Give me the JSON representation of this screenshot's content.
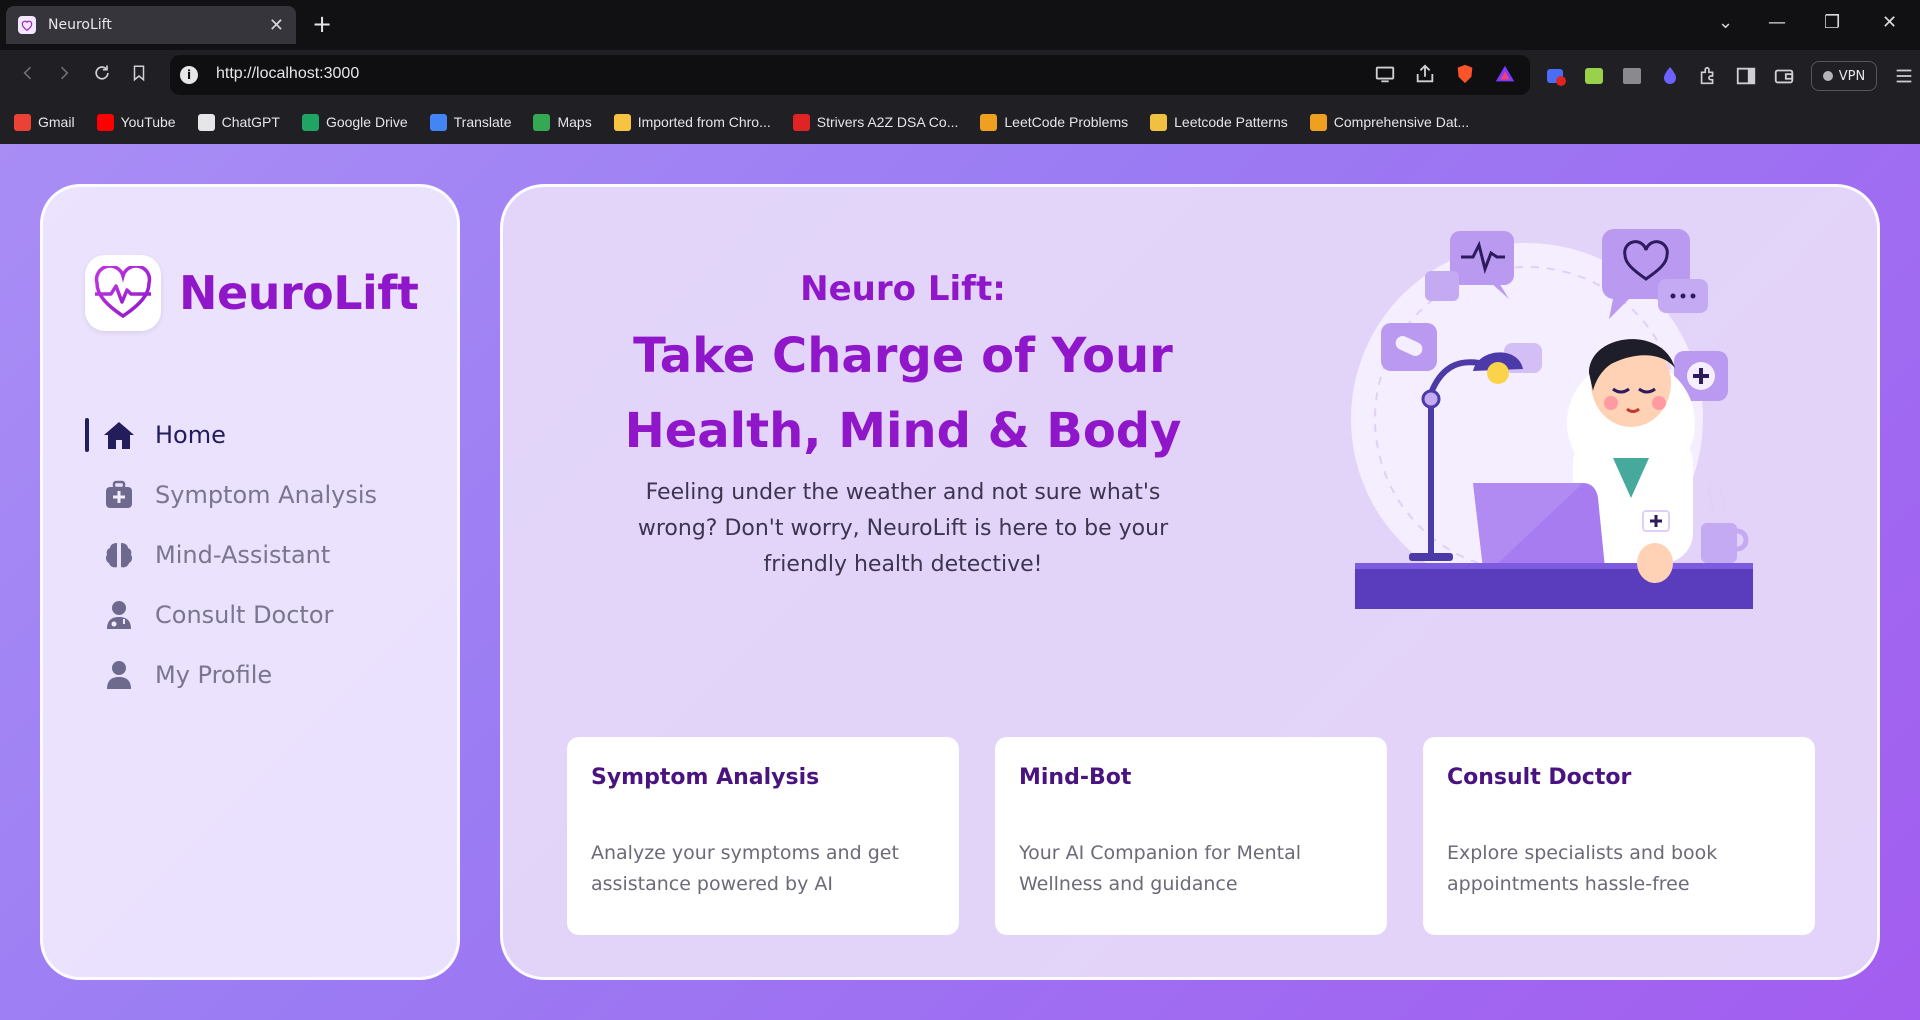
{
  "browser": {
    "tab_title": "NeuroLift",
    "new_tab": "+",
    "tab_close": "✕",
    "url": "http://localhost:3000",
    "vpn_label": "VPN",
    "window_controls": [
      "⌄",
      "—",
      "❐",
      "✕"
    ],
    "bookmarks": [
      {
        "label": "Gmail",
        "color": "#ea4335"
      },
      {
        "label": "YouTube",
        "color": "#ff0000"
      },
      {
        "label": "ChatGPT",
        "color": "#e6e6e8"
      },
      {
        "label": "Google Drive",
        "color": "#1fa463"
      },
      {
        "label": "Translate",
        "color": "#4285f4"
      },
      {
        "label": "Maps",
        "color": "#34a853"
      },
      {
        "label": "Imported from Chro...",
        "color": "#f6c343"
      },
      {
        "label": "Strivers A2Z DSA Co...",
        "color": "#e02424"
      },
      {
        "label": "LeetCode Problems",
        "color": "#f0a020"
      },
      {
        "label": "Leetcode Patterns",
        "color": "#f0c040"
      },
      {
        "label": "Comprehensive Dat...",
        "color": "#f0a020"
      }
    ]
  },
  "sidebar": {
    "brand": "NeuroLift",
    "items": [
      {
        "label": "Home",
        "icon": "home-icon",
        "active": true
      },
      {
        "label": "Symptom Analysis",
        "icon": "medkit-icon",
        "active": false
      },
      {
        "label": "Mind-Assistant",
        "icon": "brain-icon",
        "active": false
      },
      {
        "label": "Consult Doctor",
        "icon": "doctor-icon",
        "active": false
      },
      {
        "label": "My Profile",
        "icon": "user-icon",
        "active": false
      }
    ]
  },
  "hero": {
    "subtitle": "Neuro Lift:",
    "title_line1": "Take Charge of Your",
    "title_line2": "Health, Mind & Body",
    "description": "Feeling under the weather and not sure what's wrong? Don't worry, NeuroLift is here to be your friendly health detective!"
  },
  "cards": [
    {
      "title": "Symptom Analysis",
      "description": "Analyze your symptoms and get assistance powered by AI"
    },
    {
      "title": "Mind-Bot",
      "description": "Your AI Companion for Mental Wellness and guidance"
    },
    {
      "title": "Consult Doctor",
      "description": "Explore specialists and book appointments hassle-free"
    }
  ],
  "colors": {
    "brand_purple": "#8f17c9",
    "nav_active": "#231d5c",
    "nav_inactive": "#7a7590",
    "card_title": "#4a1480"
  }
}
